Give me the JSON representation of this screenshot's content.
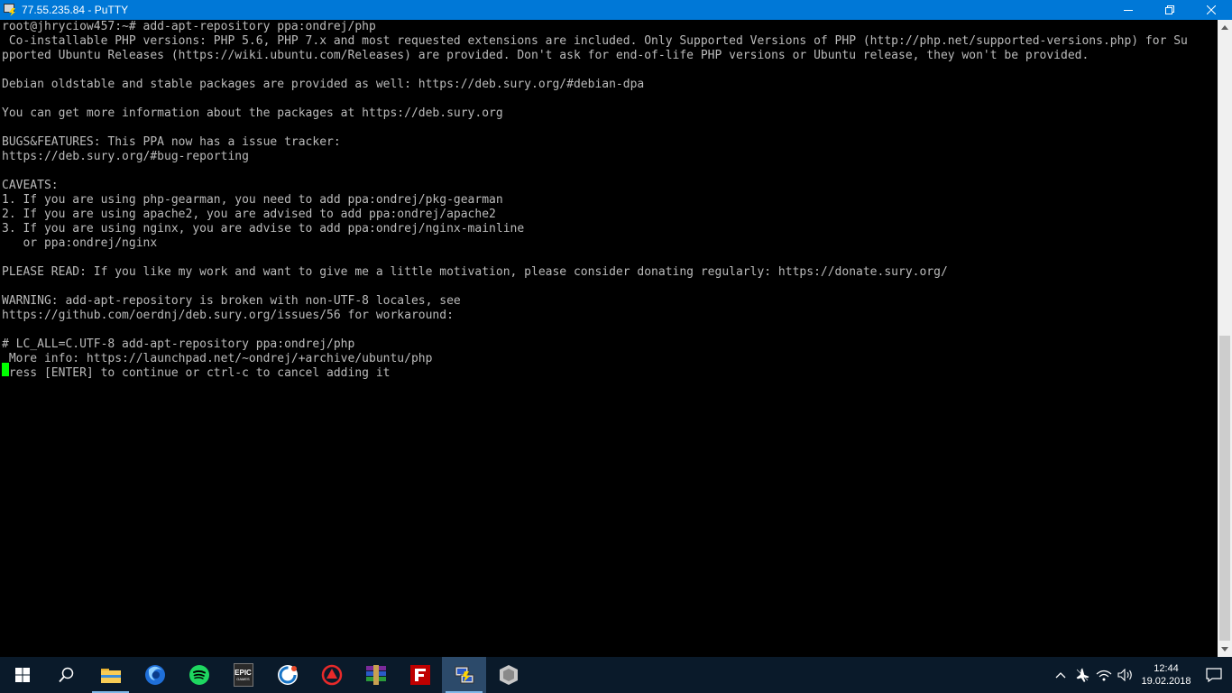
{
  "window": {
    "title": "77.55.235.84 - PuTTY",
    "minimize_icon": "minimize-icon",
    "maximize_icon": "restore-icon",
    "close_icon": "close-icon"
  },
  "terminal": {
    "lines": [
      "root@jhryciow457:~# add-apt-repository ppa:ondrej/php",
      " Co-installable PHP versions: PHP 5.6, PHP 7.x and most requested extensions are included. Only Supported Versions of PHP (http://php.net/supported-versions.php) for Su",
      "pported Ubuntu Releases (https://wiki.ubuntu.com/Releases) are provided. Don't ask for end-of-life PHP versions or Ubuntu release, they won't be provided.",
      "",
      "Debian oldstable and stable packages are provided as well: https://deb.sury.org/#debian-dpa",
      "",
      "You can get more information about the packages at https://deb.sury.org",
      "",
      "BUGS&FEATURES: This PPA now has a issue tracker:",
      "https://deb.sury.org/#bug-reporting",
      "",
      "CAVEATS:",
      "1. If you are using php-gearman, you need to add ppa:ondrej/pkg-gearman",
      "2. If you are using apache2, you are advised to add ppa:ondrej/apache2",
      "3. If you are using nginx, you are advise to add ppa:ondrej/nginx-mainline",
      "   or ppa:ondrej/nginx",
      "",
      "PLEASE READ: If you like my work and want to give me a little motivation, please consider donating regularly: https://donate.sury.org/",
      "",
      "WARNING: add-apt-repository is broken with non-UTF-8 locales, see",
      "https://github.com/oerdnj/deb.sury.org/issues/56 for workaround:",
      "",
      "# LC_ALL=C.UTF-8 add-apt-repository ppa:ondrej/php",
      " More info: https://launchpad.net/~ondrej/+archive/ubuntu/php",
      "Press [ENTER] to continue or ctrl-c to cancel adding it"
    ],
    "text_color": "#bbbbbb",
    "cursor_color": "#00ff00",
    "background": "#000000"
  },
  "taskbar": {
    "apps": [
      {
        "name": "start-button",
        "icon": "windows-logo-icon"
      },
      {
        "name": "search-button",
        "icon": "search-icon"
      },
      {
        "name": "file-explorer",
        "icon": "folder-icon"
      },
      {
        "name": "firefox",
        "icon": "firefox-icon"
      },
      {
        "name": "spotify",
        "icon": "spotify-icon"
      },
      {
        "name": "epic-games",
        "icon": "epic-games-icon"
      },
      {
        "name": "ccleaner",
        "icon": "ccleaner-icon"
      },
      {
        "name": "app-red",
        "icon": "red-app-icon"
      },
      {
        "name": "winrar",
        "icon": "winrar-icon"
      },
      {
        "name": "filezilla",
        "icon": "filezilla-icon"
      },
      {
        "name": "putty",
        "icon": "putty-icon"
      },
      {
        "name": "app-cube",
        "icon": "cube-icon"
      }
    ],
    "epic_label": "EPIC",
    "epic_sub": "GAMES",
    "clock_time": "12:44",
    "clock_date": "19.02.2018"
  }
}
